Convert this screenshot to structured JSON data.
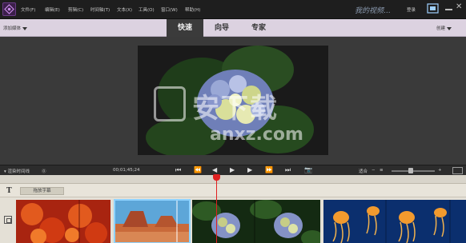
{
  "menubar": {
    "items": [
      "文件(F)",
      "编辑(E)",
      "剪辑(C)",
      "时间轴(T)",
      "文本(X)",
      "工具(O)",
      "窗口(W)",
      "帮助(H)"
    ],
    "title": "我的视频...",
    "user": "登录"
  },
  "modebar": {
    "add_media": "添加媒体",
    "tabs": [
      "快速",
      "向导",
      "专家"
    ],
    "active_tab": "快速",
    "create": "创建"
  },
  "controls": {
    "render": "渲染时间线",
    "timecode": "00;01;45;24",
    "fit": "适合"
  },
  "timeline": {
    "text_track_label": "拖放字幕"
  },
  "watermark": {
    "text": "安下载",
    "url": "anxz.com"
  },
  "colors": {
    "accent": "#e02020",
    "mode_bar": "#dcd2e0",
    "active_tab": "#3b3b3b"
  }
}
